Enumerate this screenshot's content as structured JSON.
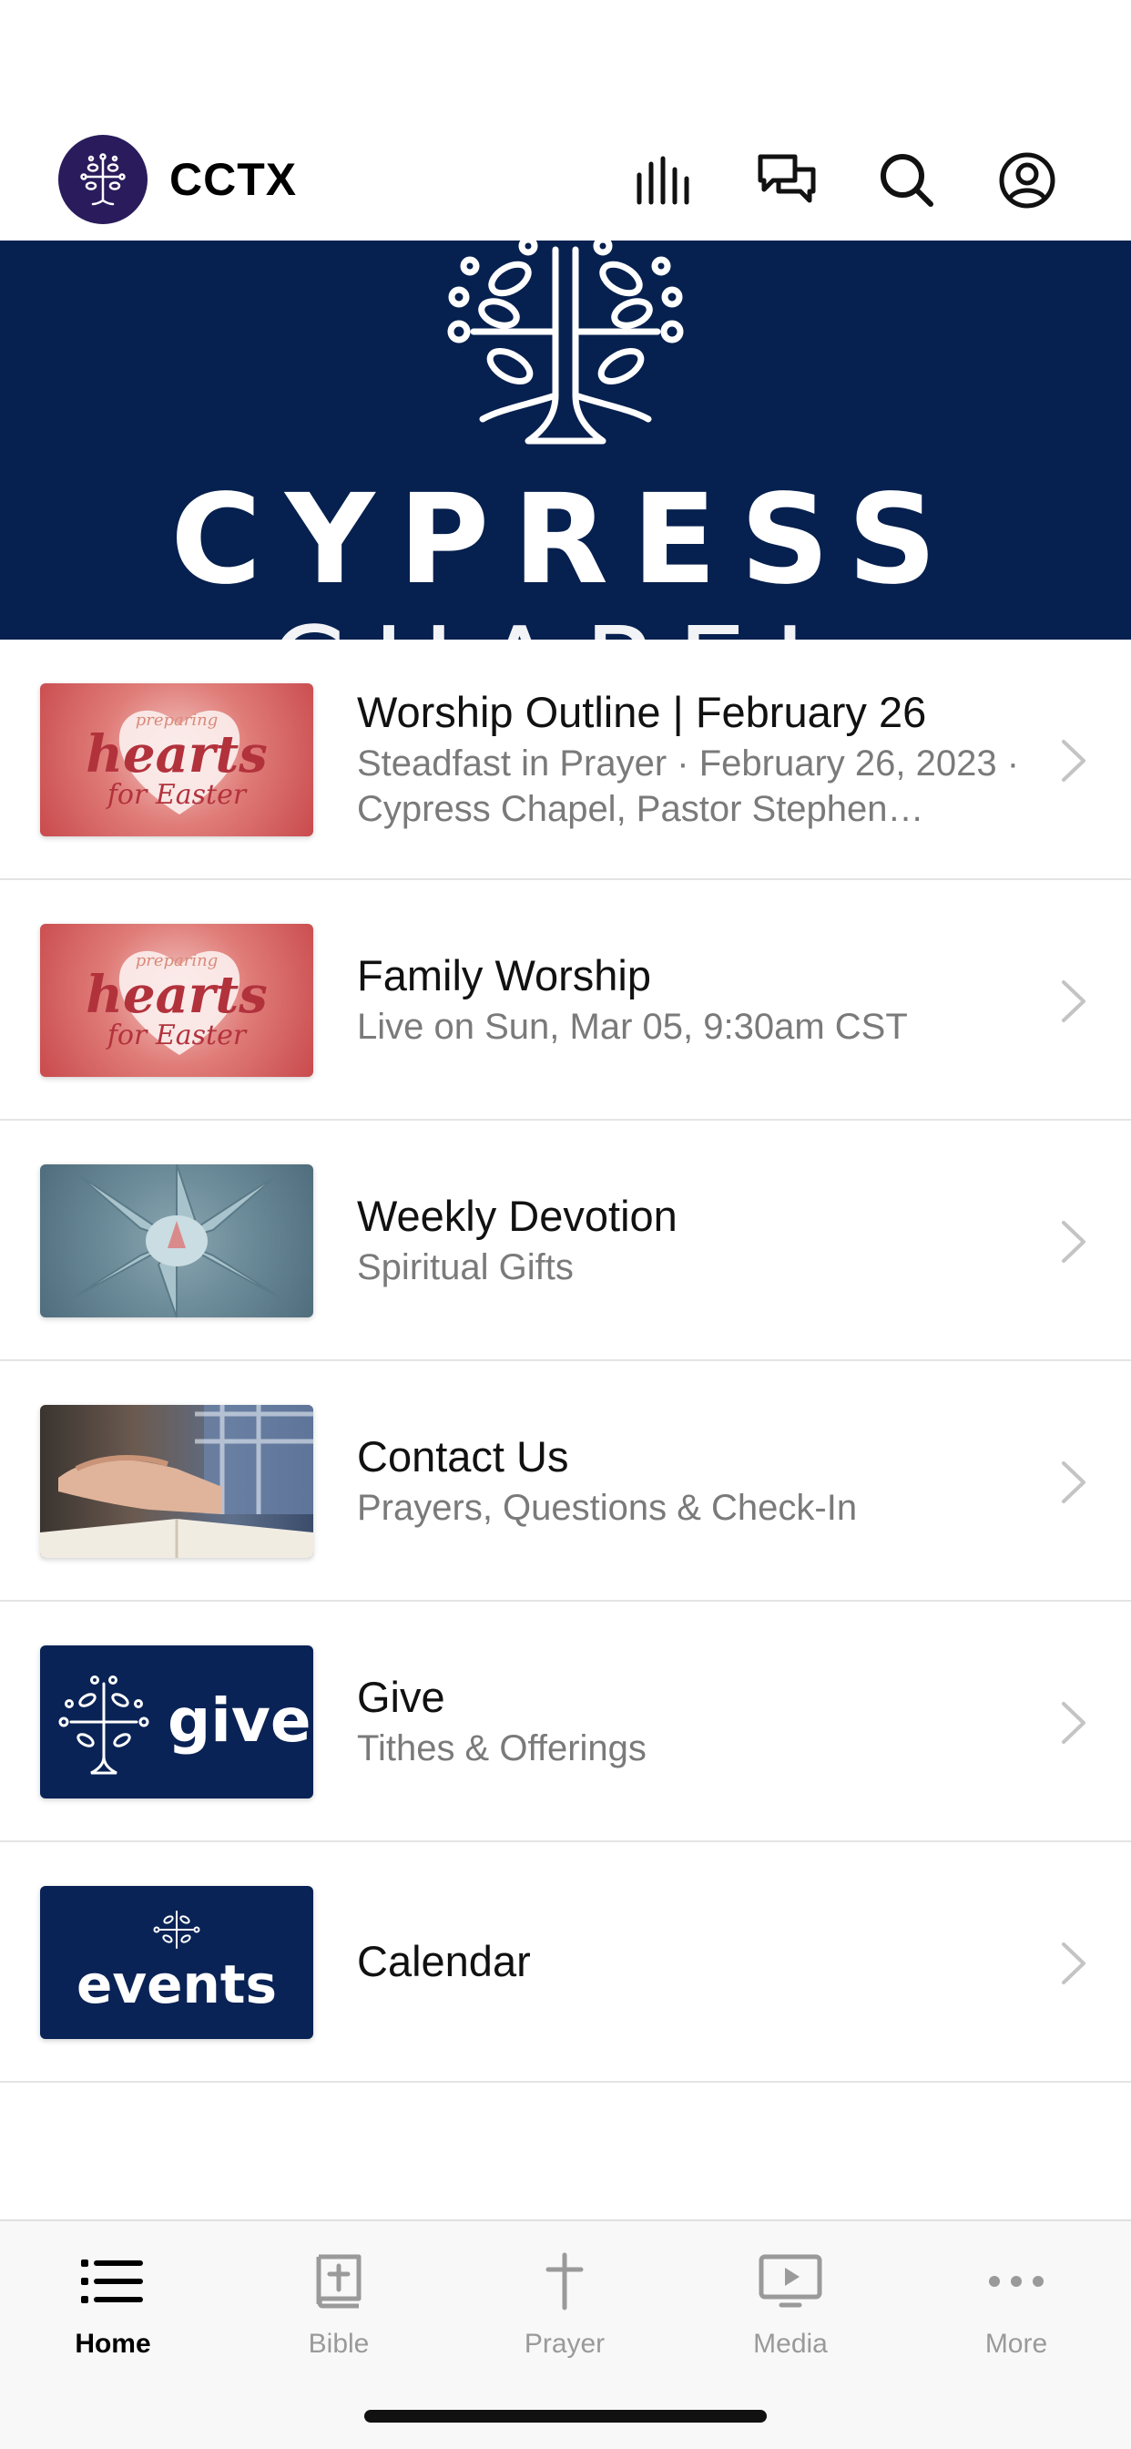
{
  "header": {
    "title": "CCTX"
  },
  "banner": {
    "brand": "CYPRESS",
    "brand_line2": "CHAPEL"
  },
  "list": [
    {
      "title": "Worship Outline | February 26",
      "subtitle": "Steadfast in Prayer · February 26, 2023 · Cypress Chapel, Pastor Stephen…",
      "thumb": "hearts-for-easter",
      "thumb_text": {
        "top": "preparing",
        "main": "hearts",
        "bottom": "for Easter"
      }
    },
    {
      "title": "Family Worship",
      "subtitle": "Live on Sun, Mar 05, 9:30am CST",
      "thumb": "hearts-for-easter",
      "thumb_text": {
        "top": "preparing",
        "main": "hearts",
        "bottom": "for Easter"
      }
    },
    {
      "title": "Weekly Devotion",
      "subtitle": "Spiritual Gifts",
      "thumb": "succulent-photo"
    },
    {
      "title": "Contact Us",
      "subtitle": "Prayers, Questions & Check-In",
      "thumb": "praying-hands-photo"
    },
    {
      "title": "Give",
      "subtitle": "Tithes & Offerings",
      "thumb": "give-logo",
      "thumb_text": {
        "main": "give"
      }
    },
    {
      "title": "Calendar",
      "subtitle": "",
      "thumb": "events-logo",
      "thumb_text": {
        "main": "events"
      }
    }
  ],
  "tabs": [
    {
      "label": "Home",
      "icon": "list-icon",
      "active": true
    },
    {
      "label": "Bible",
      "icon": "bible-icon",
      "active": false
    },
    {
      "label": "Prayer",
      "icon": "cross-icon",
      "active": false
    },
    {
      "label": "Media",
      "icon": "media-play-icon",
      "active": false
    },
    {
      "label": "More",
      "icon": "more-dots-icon",
      "active": false
    }
  ],
  "colors": {
    "banner_bg": "#06204f",
    "avatar_bg": "#2a1b5c",
    "navy_thumb": "#0a2356",
    "subtitle_gray": "#7a7a7a",
    "tab_inactive": "#9a9a9a"
  }
}
